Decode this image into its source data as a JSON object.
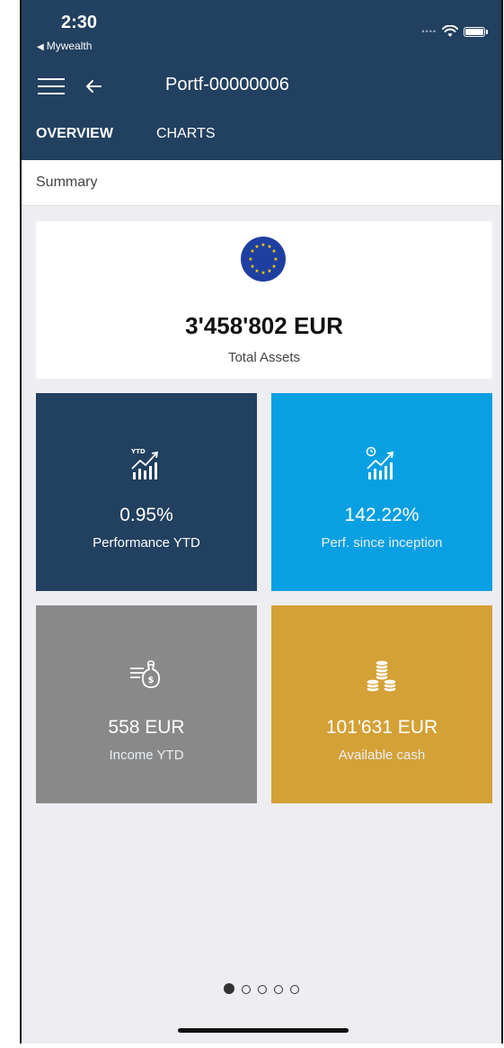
{
  "status": {
    "time": "2:30",
    "back_app": "Mywealth"
  },
  "nav": {
    "title": "Portf-00000006"
  },
  "tabs": [
    {
      "label": "OVERVIEW",
      "active": true
    },
    {
      "label": "CHARTS",
      "active": false
    }
  ],
  "summary": {
    "label": "Summary"
  },
  "total_assets": {
    "value": "3'458'802 EUR",
    "label": "Total Assets",
    "flag_icon": "eu-flag-icon"
  },
  "tiles": [
    {
      "value": "0.95%",
      "label": "Performance YTD",
      "icon": "ytd-growth-chart-icon",
      "color": "#22405f"
    },
    {
      "value": "142.22%",
      "label": "Perf. since inception",
      "icon": "clock-growth-chart-icon",
      "color": "#08a0e2"
    },
    {
      "value": "558 EUR",
      "label": "Income YTD",
      "icon": "income-money-bag-icon",
      "color": "#898989"
    },
    {
      "value": "101'631 EUR",
      "label": "Available cash",
      "icon": "coin-stacks-icon",
      "color": "#d4a136"
    }
  ],
  "pager": {
    "pages": 5,
    "active_index": 0
  },
  "colors": {
    "header": "#22405f",
    "background": "#ededf2"
  }
}
